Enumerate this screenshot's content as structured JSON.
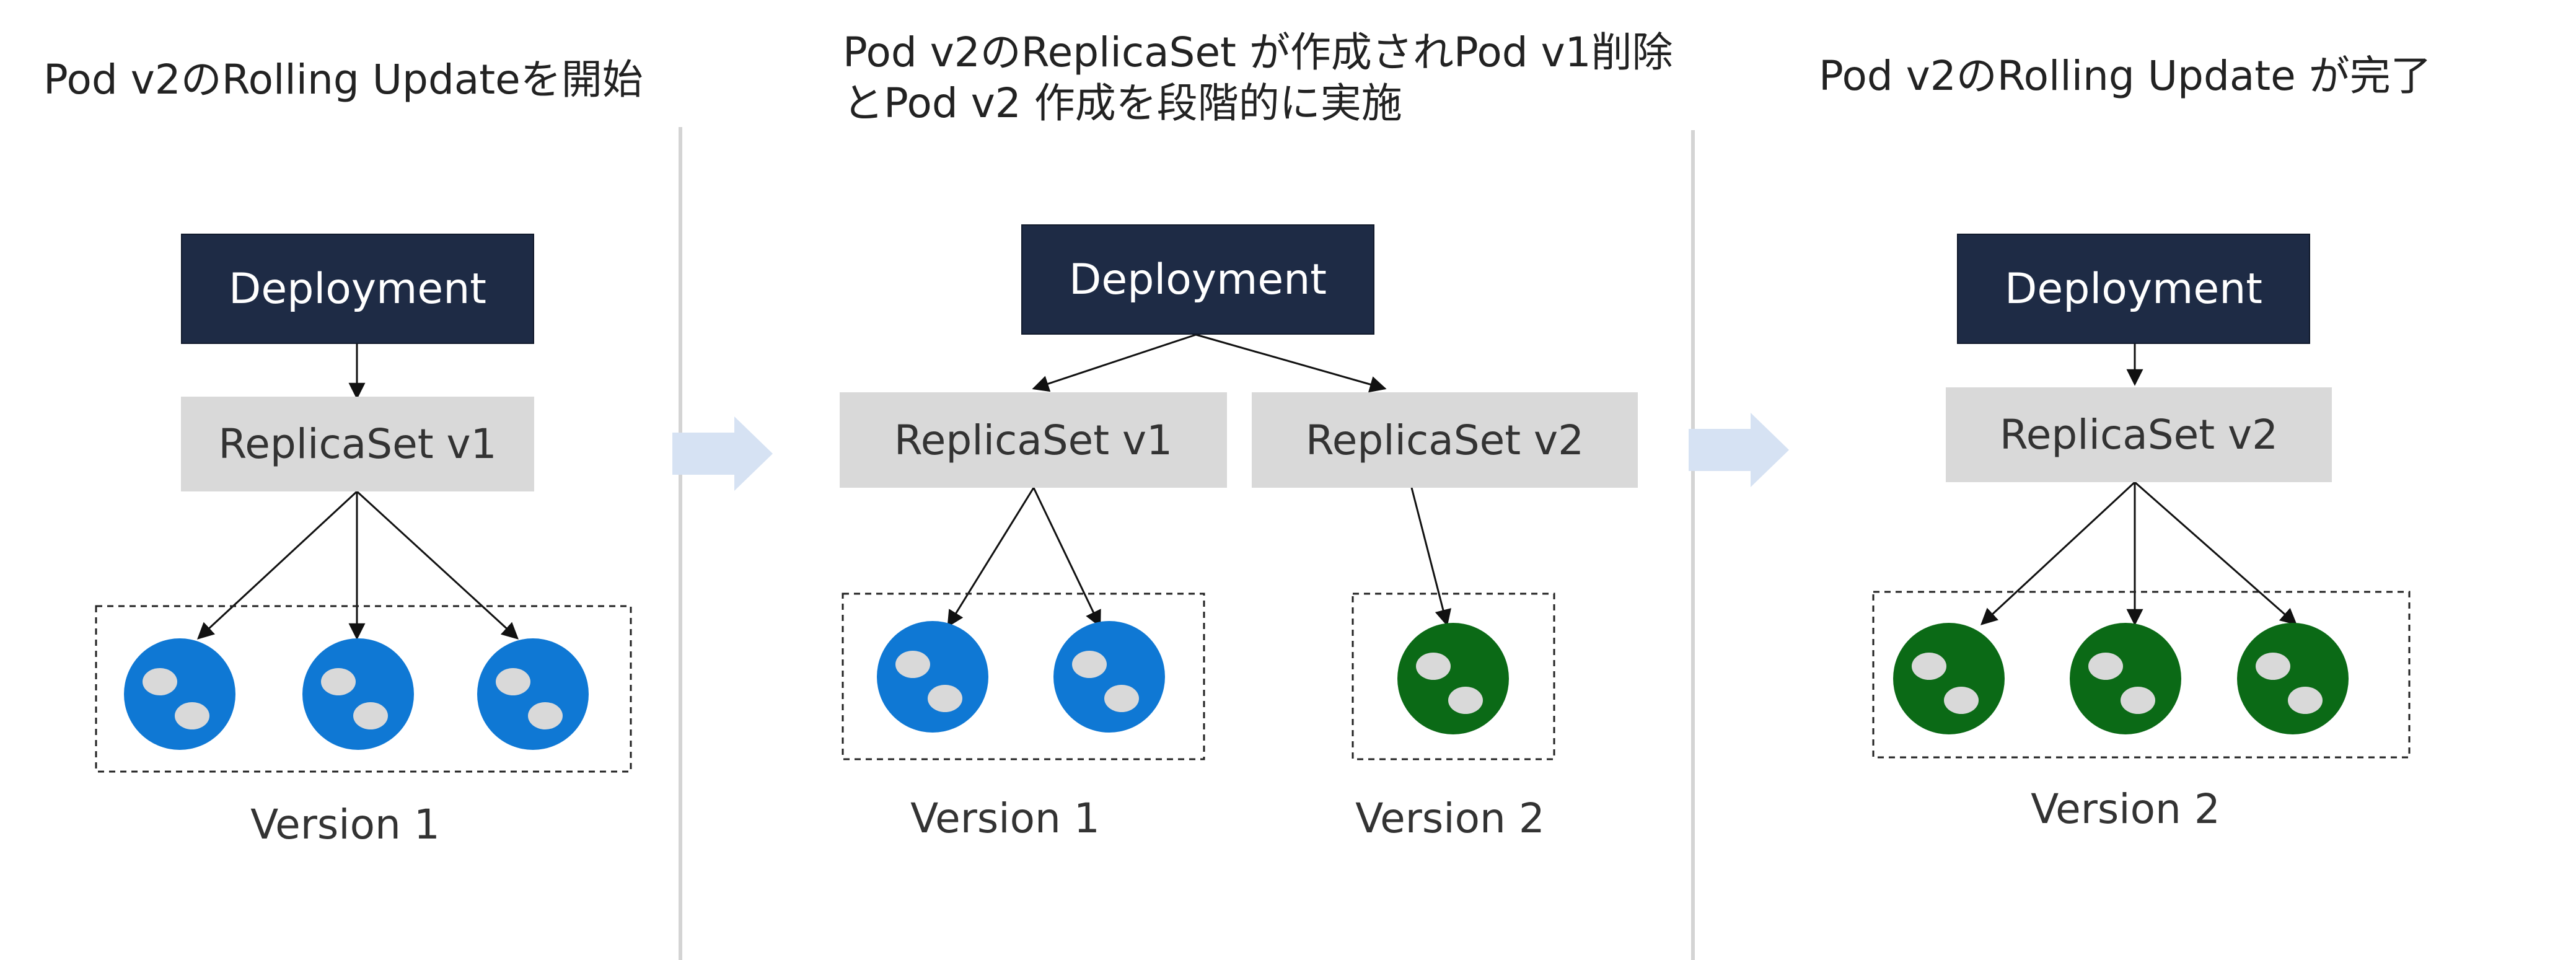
{
  "stages": [
    {
      "caption": "Pod v2のRolling Updateを開始",
      "deployment": "Deployment",
      "replicasets": [
        "ReplicaSet v1"
      ],
      "versions": [
        "Version 1"
      ]
    },
    {
      "caption_line1": "Pod v2のReplicaSet が作成されPod v1削除",
      "caption_line2": "とPod v2 作成を段階的に実施",
      "deployment": "Deployment",
      "replicasets": [
        "ReplicaSet v1",
        "ReplicaSet v2"
      ],
      "versions": [
        "Version 1",
        "Version 2"
      ]
    },
    {
      "caption": "Pod v2のRolling Update が完了",
      "deployment": "Deployment",
      "replicasets": [
        "ReplicaSet v2"
      ],
      "versions": [
        "Version 2"
      ]
    }
  ],
  "colors": {
    "deployment_fill": "#1e2b45",
    "replicaset_fill": "#d9d9d9",
    "pod_v1": "#0f78d4",
    "pod_v2": "#0b6a16",
    "pod_dot": "#d9d9d9",
    "arrow_flow": "#d6e2f3",
    "divider": "#d4d4d4"
  },
  "icons": [
    "pod-v1-icon",
    "pod-v2-icon",
    "flow-arrow-icon"
  ]
}
